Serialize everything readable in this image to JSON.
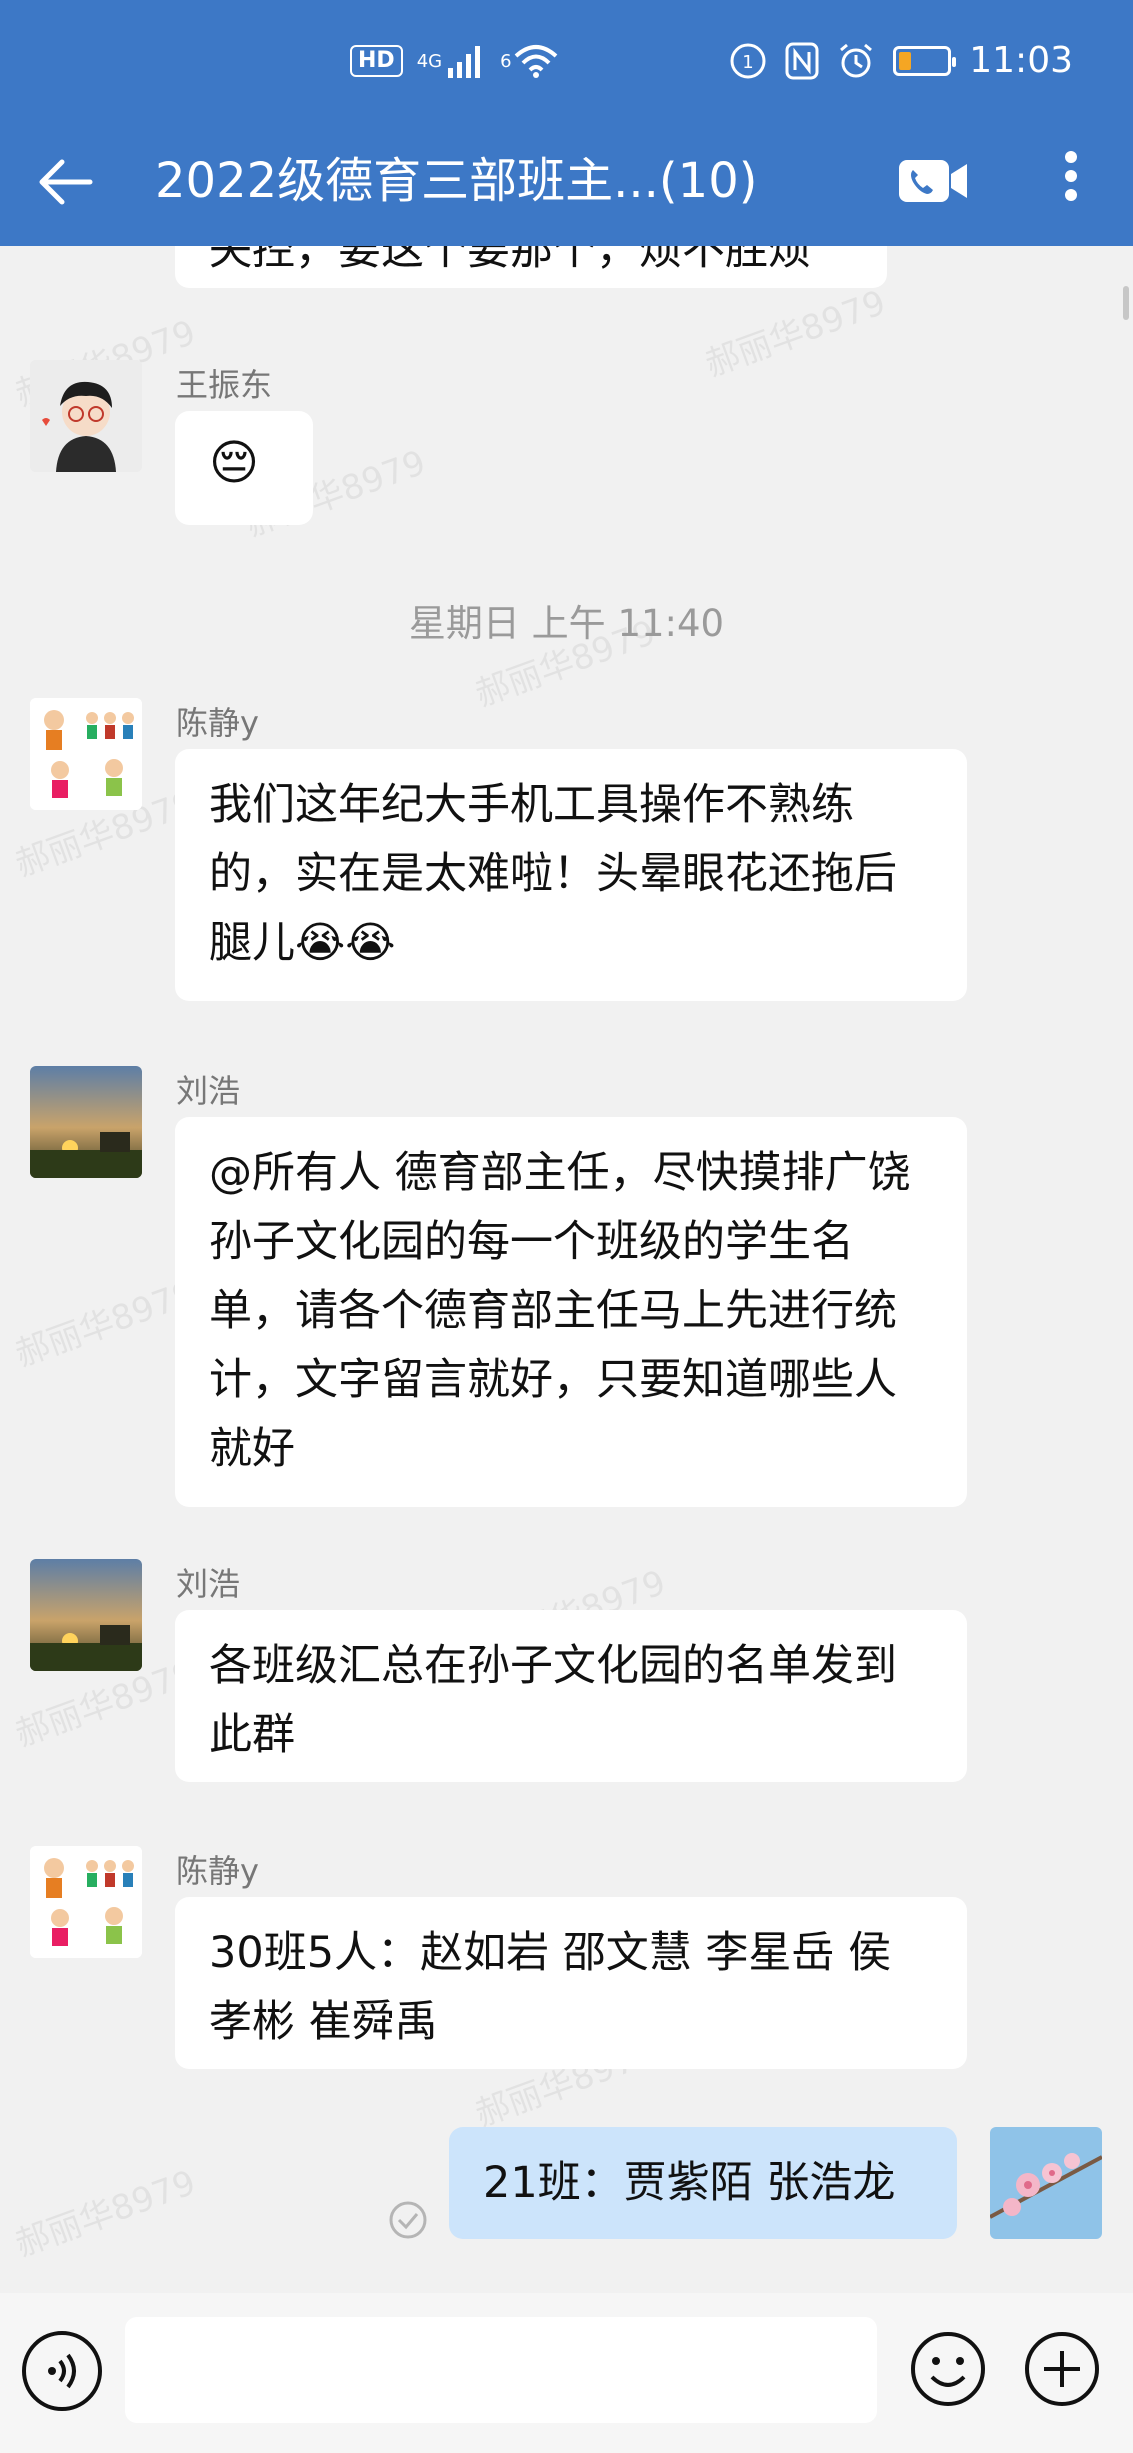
{
  "status_bar": {
    "hd": "HD",
    "network": "4G",
    "wifi_label": "6",
    "time": "11:03"
  },
  "header": {
    "title": "2022级德育三部班主...(10)"
  },
  "messages": [
    {
      "partial_text": "失控，要这个要那个，烦不胜烦"
    },
    {
      "sender": "王振东",
      "text": "😔"
    },
    {
      "time_separator": "星期日  上午 11:40"
    },
    {
      "sender": "陈静y",
      "text": "我们这年纪大手机工具操作不熟练的，实在是太难啦！头晕眼花还拖后腿儿😭😭"
    },
    {
      "sender": "刘浩",
      "text": "@所有人  德育部主任，尽快摸排广饶孙子文化园的每一个班级的学生名单，请各个德育部主任马上先进行统计，文字留言就好，只要知道哪些人就好"
    },
    {
      "sender": "刘浩",
      "text": "各班级汇总在孙子文化园的名单发到此群"
    },
    {
      "sender": "陈静y",
      "text": "30班5人：赵如岩  邵文慧  李星岳  侯孝彬  崔舜禹"
    },
    {
      "sender": "me",
      "text": "21班：贾紫陌  张浩龙"
    }
  ],
  "watermark": "郝丽华8979",
  "input": {
    "placeholder": ""
  },
  "colors": {
    "header": "#3d78c6",
    "my_bubble": "#cce4fb",
    "bg": "#f1f1f1"
  }
}
